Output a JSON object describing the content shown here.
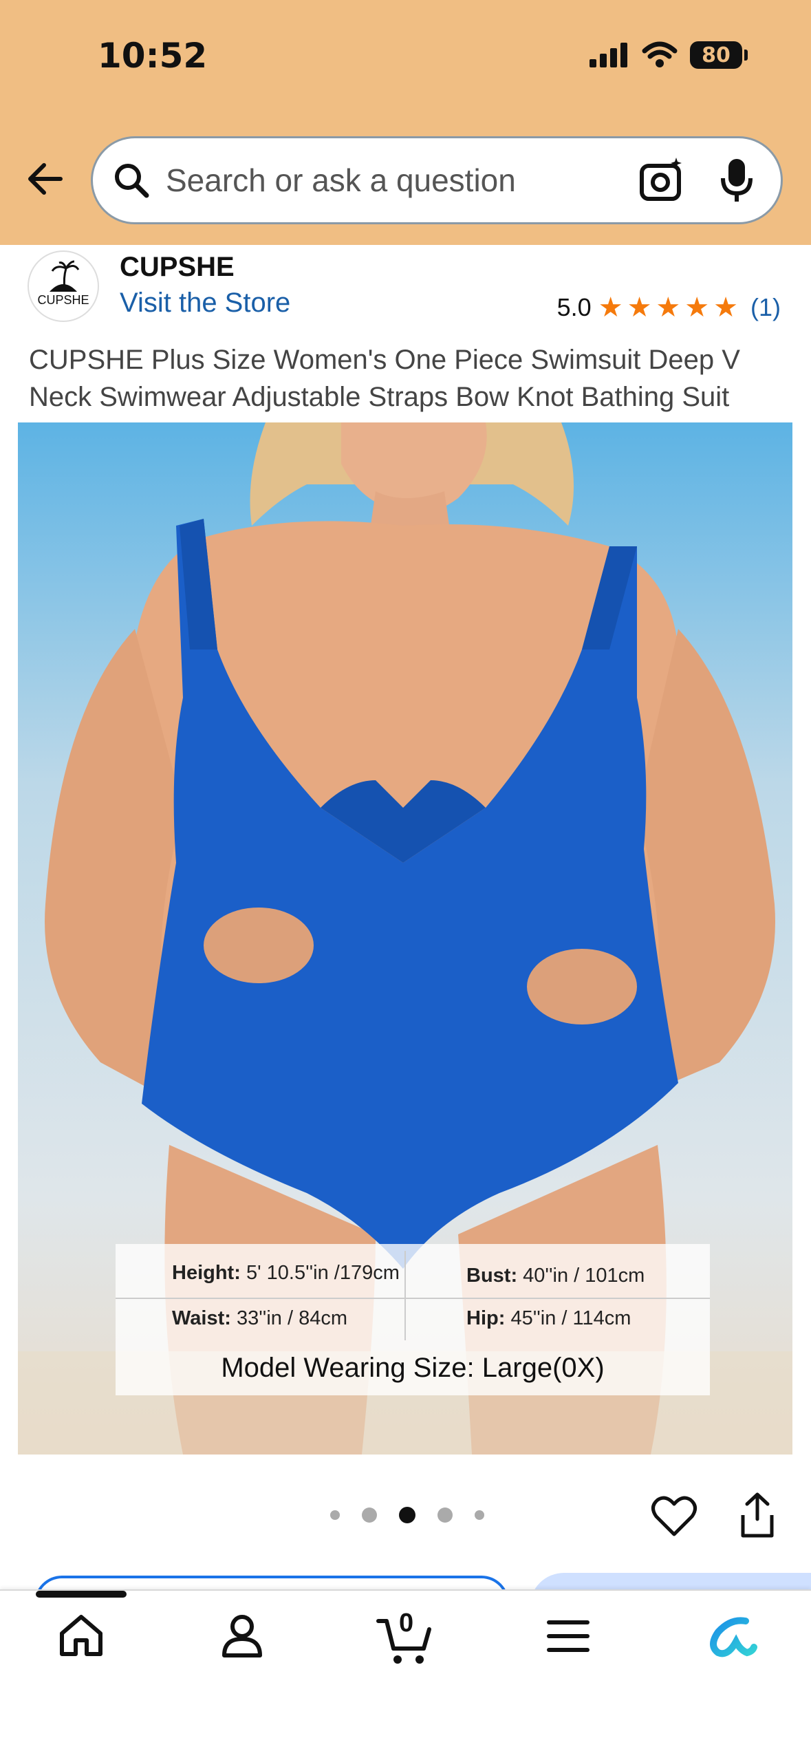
{
  "status_bar": {
    "time": "10:52",
    "battery": "80"
  },
  "search": {
    "placeholder": "Search or ask a question"
  },
  "store": {
    "logo_text": "CUPSHE",
    "brand": "CUPSHE",
    "visit_label": "Visit the Store",
    "rating_value": "5.0",
    "rating_stars": 5,
    "rating_count": "(1)"
  },
  "product": {
    "title": "CUPSHE Plus Size Women's One Piece Swimsuit Deep V Neck Swimwear Adjustable Straps Bow Knot Bathing Suit"
  },
  "image_overlay": {
    "height_label": "Height:",
    "height_value": "5' 10.5''in /179cm",
    "bust_label": "Bust:",
    "bust_value": "40''in / 101cm",
    "waist_label": "Waist:",
    "waist_value": "33''in / 84cm",
    "hip_label": "Hip:",
    "hip_value": "45''in / 114cm",
    "model_size": "Model Wearing Size: Large(0X)"
  },
  "carousel": {
    "total": 5,
    "active_index": 2
  },
  "bottom_nav": {
    "items": [
      "home-icon",
      "account-icon",
      "cart-icon",
      "menu-icon",
      "rufus-icon"
    ],
    "cart_count": "0"
  },
  "colors": {
    "header_bg": "#f0be83",
    "link": "#1a5fa8",
    "star": "#f57a0c",
    "swimsuit": "#1b5fc8"
  }
}
